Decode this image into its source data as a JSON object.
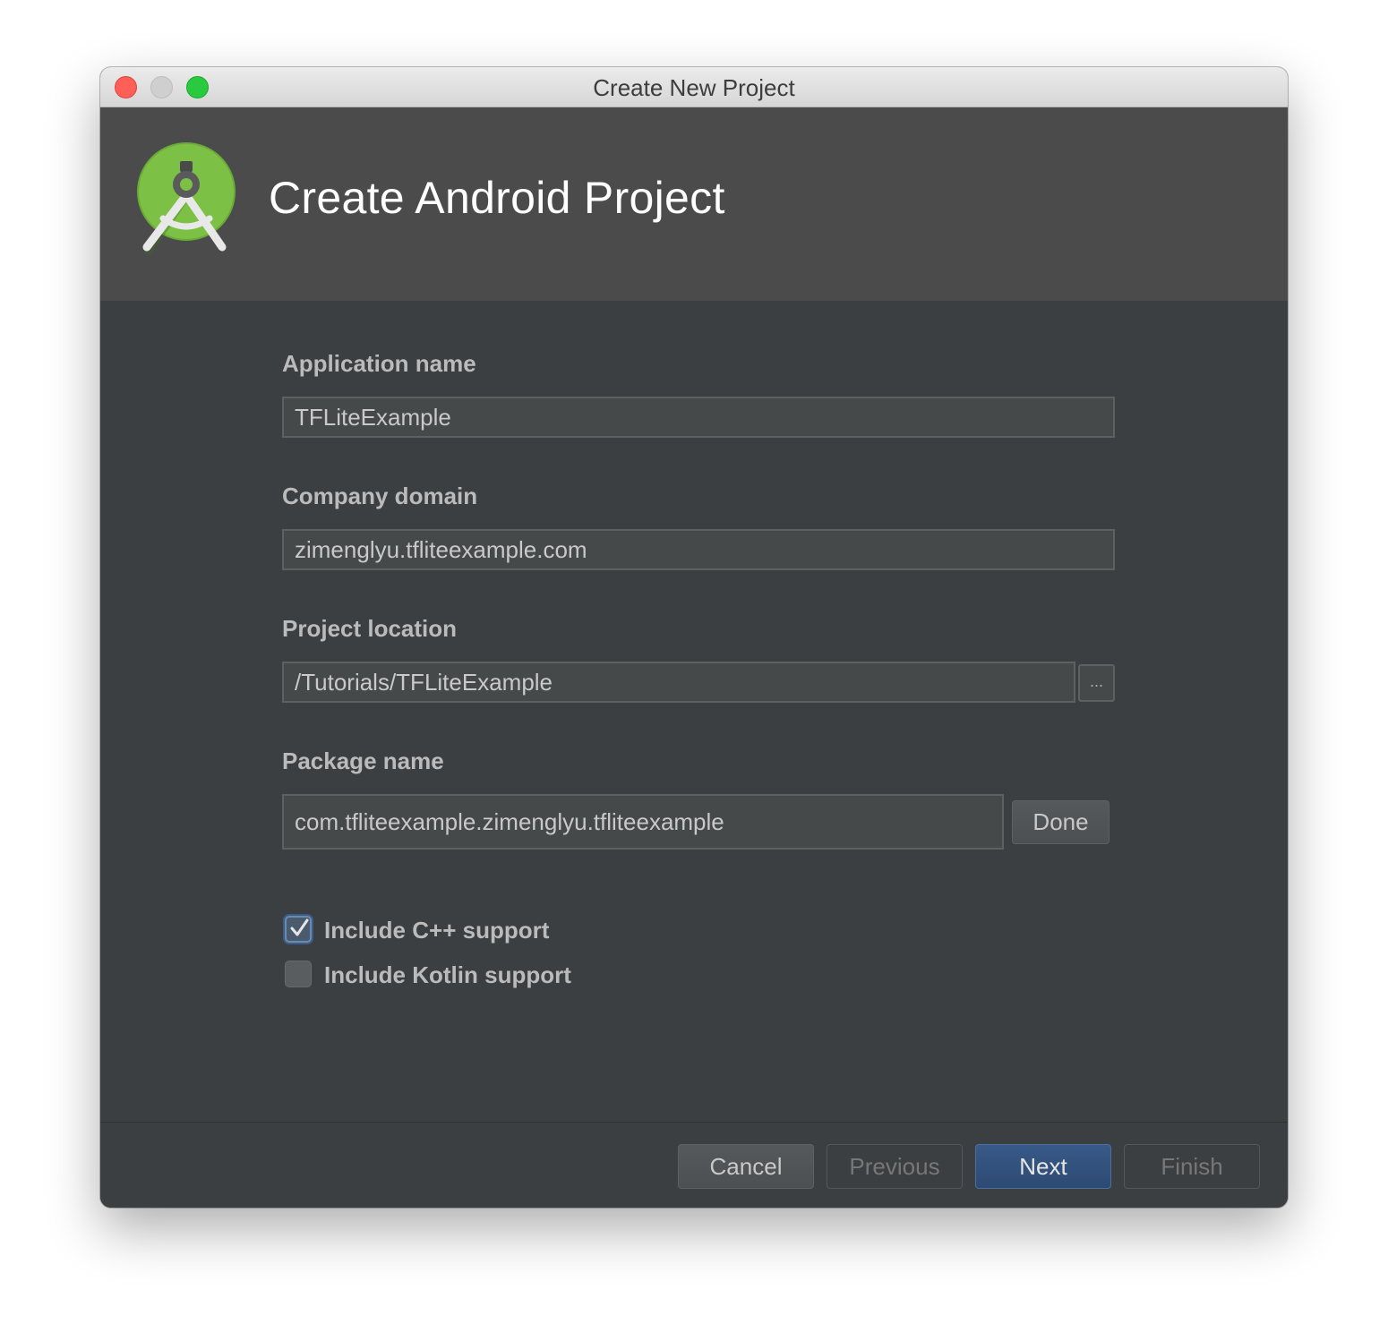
{
  "window": {
    "title": "Create New Project"
  },
  "header": {
    "title": "Create Android Project",
    "logo_icon": "android-studio-logo-icon"
  },
  "form": {
    "app_name": {
      "label": "Application name",
      "value": "TFLiteExample"
    },
    "company_domain": {
      "label": "Company domain",
      "value": "zimenglyu.tfliteexample.com"
    },
    "project_location": {
      "label": "Project location",
      "value": "/Tutorials/TFLiteExample",
      "browse_label": "..."
    },
    "package_name": {
      "label": "Package name",
      "value": "com.tfliteexample.zimenglyu.tfliteexample",
      "done_label": "Done"
    },
    "include_cpp": {
      "label": "Include C++ support",
      "checked": true
    },
    "include_kotlin": {
      "label": "Include Kotlin support",
      "checked": false
    }
  },
  "footer": {
    "cancel": "Cancel",
    "previous": "Previous",
    "next": "Next",
    "finish": "Finish"
  },
  "colors": {
    "header_bg": "#4b4b4b",
    "content_bg": "#3c3f41",
    "accent_next": "#365880",
    "logo_green": "#7cc145"
  }
}
